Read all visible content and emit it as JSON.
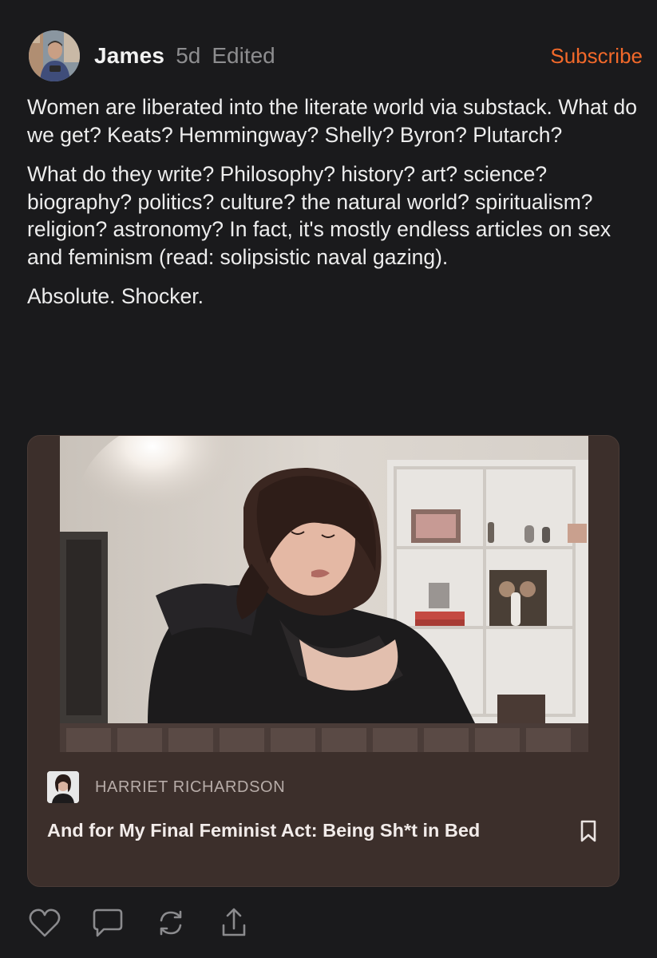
{
  "post": {
    "author": "James",
    "age": "5d",
    "edited_label": "Edited",
    "subscribe_label": "Subscribe",
    "paragraphs": [
      "Women are liberated into the literate world via substack. What do we get? Keats? Hemmingway? Shelly? Byron? Plutarch?",
      "What do they write? Philosophy? history? art? science? biography? politics? culture? the natural world? spiritualism? religion? astronomy? In fact, it's mostly endless articles on sex and feminism (read: solipsistic naval gazing).",
      "Absolute. Shocker."
    ]
  },
  "embed": {
    "publication": "HARRIET RICHARDSON",
    "title": "And for My Final Feminist Act: Being Sh*t in Bed",
    "bookmark_icon": "bookmark-icon"
  },
  "actions": [
    {
      "icon": "heart-icon"
    },
    {
      "icon": "comment-icon"
    },
    {
      "icon": "restack-icon"
    },
    {
      "icon": "share-icon"
    }
  ],
  "colors": {
    "background": "#1a1a1c",
    "accent": "#f2692a",
    "card_background": "#3c2f2b",
    "muted_text": "#8d8d8f"
  }
}
